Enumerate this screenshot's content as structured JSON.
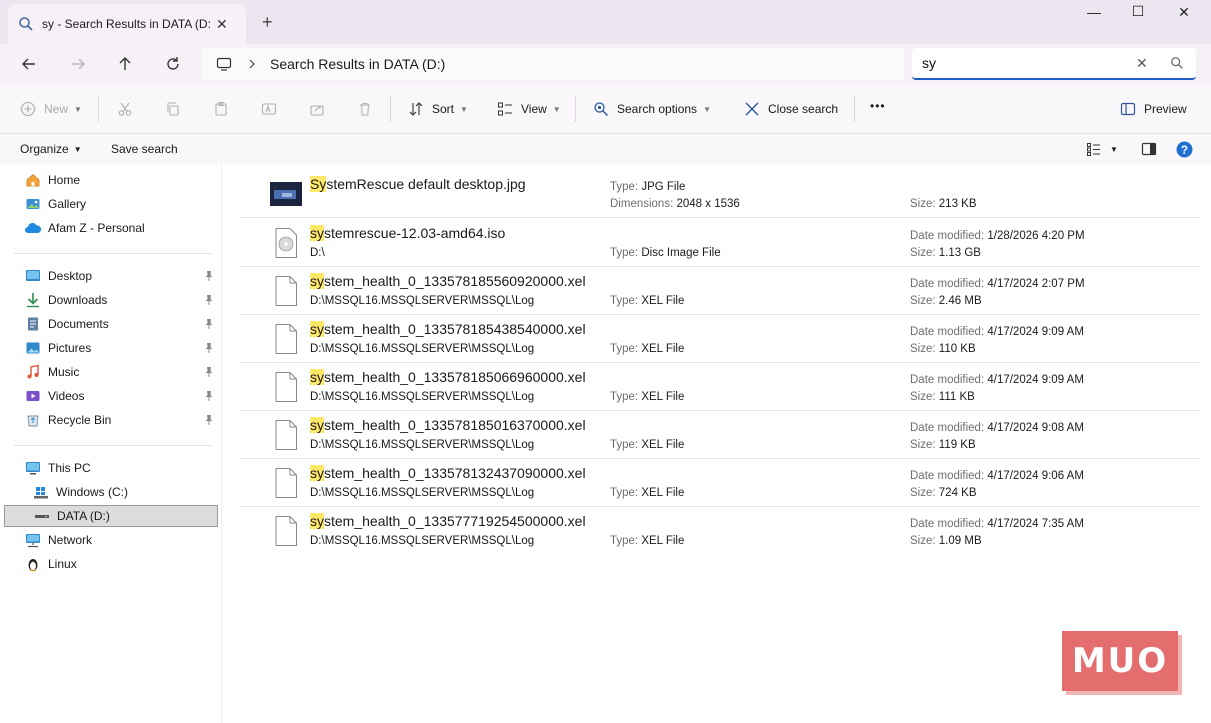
{
  "window": {
    "tab_title": "sy - Search Results in DATA (D:)",
    "new_tab": "+",
    "minimize": "—",
    "maximize": "☐",
    "close": "✕"
  },
  "address": {
    "path": "Search Results in DATA (D:)"
  },
  "search": {
    "value": "sy"
  },
  "toolbar": {
    "new_label": "New",
    "sort_label": "Sort",
    "view_label": "View",
    "search_options_label": "Search options",
    "close_search_label": "Close search",
    "more_label": "•••",
    "preview_label": "Preview"
  },
  "commandbar": {
    "organize_label": "Organize",
    "save_search_label": "Save search"
  },
  "sidebar": {
    "items": [
      {
        "label": "Home"
      },
      {
        "label": "Gallery"
      },
      {
        "label": "Afam Z - Personal"
      },
      {
        "label": "Desktop"
      },
      {
        "label": "Downloads"
      },
      {
        "label": "Documents"
      },
      {
        "label": "Pictures"
      },
      {
        "label": "Music"
      },
      {
        "label": "Videos"
      },
      {
        "label": "Recycle Bin"
      },
      {
        "label": "This PC"
      },
      {
        "label": "Windows (C:)"
      },
      {
        "label": "DATA (D:)"
      },
      {
        "label": "Network"
      },
      {
        "label": "Linux"
      }
    ]
  },
  "labels": {
    "type": "Type:",
    "dimensions": "Dimensions:",
    "size": "Size:",
    "date_modified": "Date modified:"
  },
  "files": [
    {
      "match": "Sy",
      "rest": "stemRescue default desktop.jpg",
      "location": "",
      "type": "JPG File",
      "dimensions": "2048 x 1536",
      "date": "",
      "size": "213 KB"
    },
    {
      "match": "sy",
      "rest": "stemrescue-12.03-amd64.iso",
      "location": "D:\\",
      "type": "Disc Image File",
      "dimensions": "",
      "date": "1/28/2026 4:20 PM",
      "size": "1.13 GB"
    },
    {
      "match": "sy",
      "rest": "stem_health_0_133578185560920000.xel",
      "location": "D:\\MSSQL16.MSSQLSERVER\\MSSQL\\Log",
      "type": "XEL File",
      "dimensions": "",
      "date": "4/17/2024 2:07 PM",
      "size": "2.46 MB"
    },
    {
      "match": "sy",
      "rest": "stem_health_0_133578185438540000.xel",
      "location": "D:\\MSSQL16.MSSQLSERVER\\MSSQL\\Log",
      "type": "XEL File",
      "dimensions": "",
      "date": "4/17/2024 9:09 AM",
      "size": "110 KB"
    },
    {
      "match": "sy",
      "rest": "stem_health_0_133578185066960000.xel",
      "location": "D:\\MSSQL16.MSSQLSERVER\\MSSQL\\Log",
      "type": "XEL File",
      "dimensions": "",
      "date": "4/17/2024 9:09 AM",
      "size": "111 KB"
    },
    {
      "match": "sy",
      "rest": "stem_health_0_133578185016370000.xel",
      "location": "D:\\MSSQL16.MSSQLSERVER\\MSSQL\\Log",
      "type": "XEL File",
      "dimensions": "",
      "date": "4/17/2024 9:08 AM",
      "size": "119 KB"
    },
    {
      "match": "sy",
      "rest": "stem_health_0_133578132437090000.xel",
      "location": "D:\\MSSQL16.MSSQLSERVER\\MSSQL\\Log",
      "type": "XEL File",
      "dimensions": "",
      "date": "4/17/2024 9:06 AM",
      "size": "724 KB"
    },
    {
      "match": "sy",
      "rest": "stem_health_0_133577719254500000.xel",
      "location": "D:\\MSSQL16.MSSQLSERVER\\MSSQL\\Log",
      "type": "XEL File",
      "dimensions": "",
      "date": "4/17/2024 7:35 AM",
      "size": "1.09 MB"
    }
  ],
  "watermark": "MUO",
  "colors": {
    "highlight": "#ffe76a",
    "accent": "#1f5fbf",
    "watermark": "#e46e6e"
  }
}
